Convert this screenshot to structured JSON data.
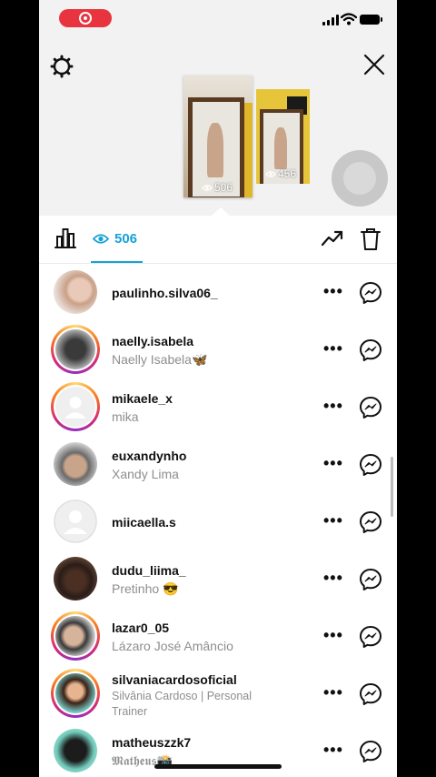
{
  "status_bar": {
    "recording": true
  },
  "story_preview": {
    "thumbnails": [
      {
        "views": "506"
      },
      {
        "views": "456"
      }
    ]
  },
  "toolbar": {
    "views_count": "506",
    "accent_color": "#16a2d6"
  },
  "viewers": [
    {
      "username": "paulinho.silva06_",
      "full_name": "",
      "story_ring": false
    },
    {
      "username": "naelly.isabela",
      "full_name": "Naelly Isabela🦋",
      "story_ring": true
    },
    {
      "username": "mikaele_x",
      "full_name": "mika",
      "story_ring": true
    },
    {
      "username": "euxandynho",
      "full_name": "Xandy Lima",
      "story_ring": false
    },
    {
      "username": "miicaella.s",
      "full_name": "",
      "story_ring": false
    },
    {
      "username": "dudu_liima_",
      "full_name": "Pretinho 😎",
      "story_ring": false
    },
    {
      "username": "lazar0_05",
      "full_name": "Lázaro José Amâncio",
      "story_ring": true
    },
    {
      "username": "silvaniacardosoficial",
      "full_name": "Silvânia Cardoso | Personal Trainer",
      "story_ring": true
    },
    {
      "username": "matheuszzk7",
      "full_name": "𝕸𝖆𝖙𝖍𝖊𝖚𝖘📸",
      "story_ring": false
    }
  ],
  "more_label": "•••"
}
